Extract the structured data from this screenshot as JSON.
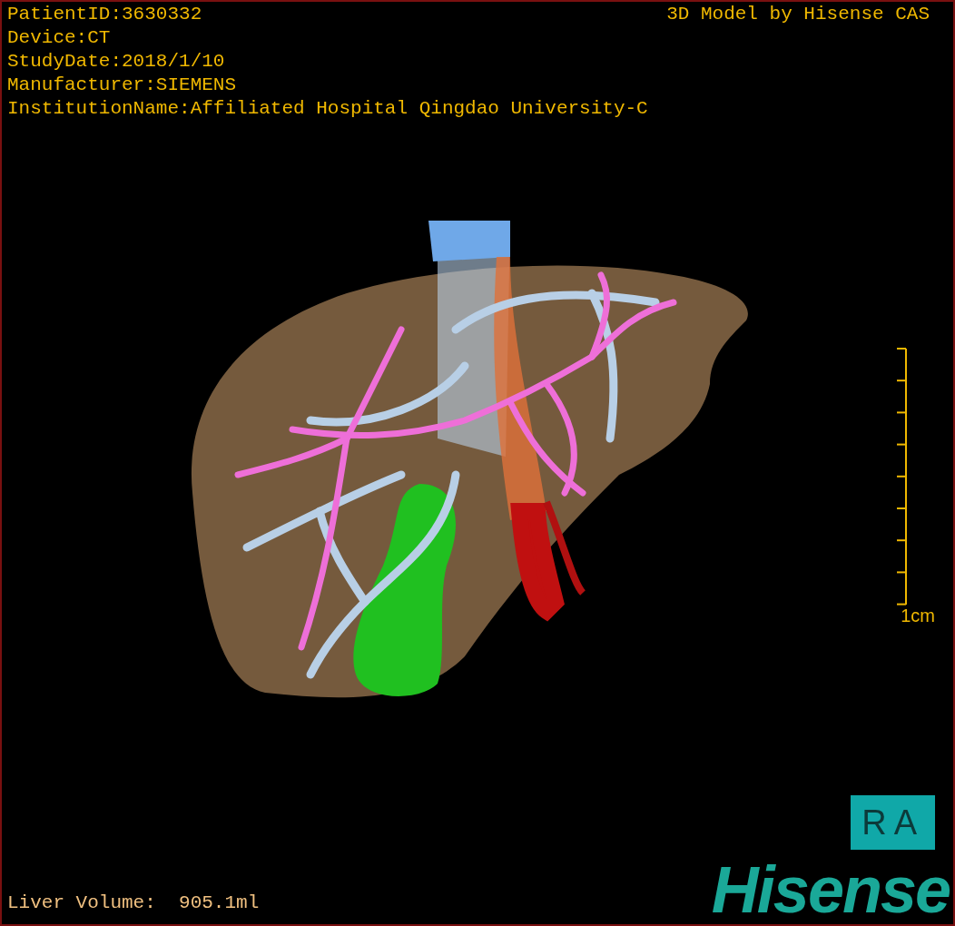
{
  "overlay": {
    "info_lines": [
      "PatientID:3630332",
      "Device:CT",
      "StudyDate:2018/1/10",
      "Manufacturer:SIEMENS",
      "InstitutionName:Affiliated Hospital Qingdao University-C"
    ],
    "title": "3D Model by Hisense CAS"
  },
  "scale_bar": {
    "label": "1cm"
  },
  "orientation": {
    "label": "RA"
  },
  "footer": {
    "volume": "Liver Volume:  905.1ml"
  },
  "logo": {
    "text": "Hisense"
  }
}
